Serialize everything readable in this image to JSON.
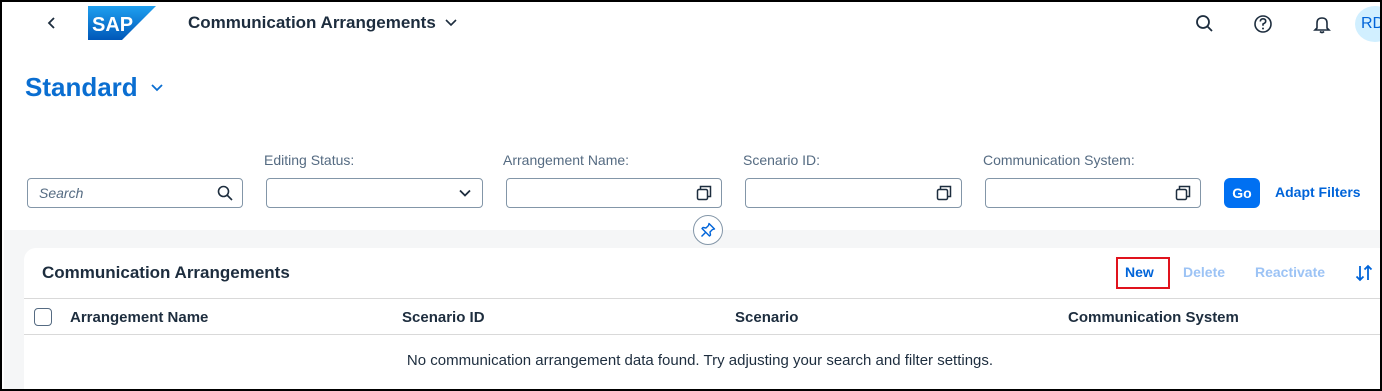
{
  "shell": {
    "logo_text": "SAP",
    "app_title": "Communication Arrangements",
    "avatar_initials": "RD",
    "icons": [
      "back-icon",
      "search-icon",
      "help-icon",
      "notification-bell-icon"
    ]
  },
  "variant": {
    "title": "Standard"
  },
  "filters": {
    "search_placeholder": "Search",
    "editing_status_label": "Editing Status:",
    "arrangement_name_label": "Arrangement Name:",
    "scenario_id_label": "Scenario ID:",
    "communication_system_label": "Communication System:",
    "go_label": "Go",
    "adapt_filters_label": "Adapt Filters"
  },
  "table": {
    "title": "Communication Arrangements",
    "toolbar": {
      "new": "New",
      "delete": "Delete",
      "reactivate": "Reactivate"
    },
    "columns": [
      "Arrangement Name",
      "Scenario ID",
      "Scenario",
      "Communication System"
    ],
    "no_data": "No communication arrangement data found. Try adjusting your search and filter settings."
  },
  "colors": {
    "brand_blue": "#0a6ed1",
    "button_blue": "#0070f2",
    "highlight_red": "#e0131d"
  }
}
